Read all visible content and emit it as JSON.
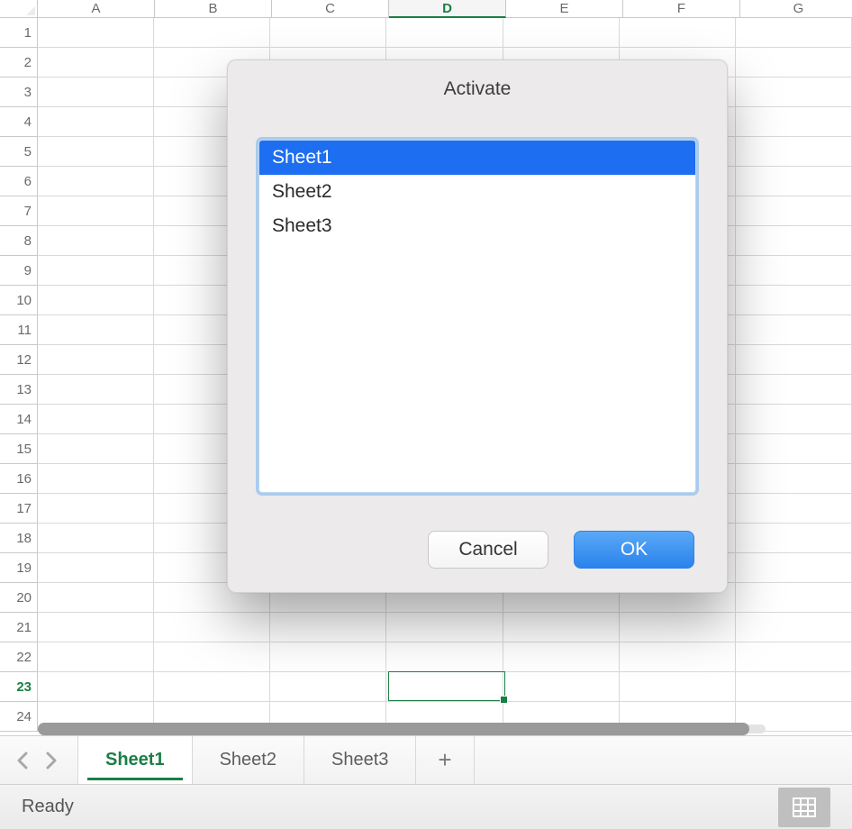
{
  "colors": {
    "accent_green": "#1a7f46",
    "accent_blue": "#1d6ef0"
  },
  "grid": {
    "columns": [
      "A",
      "B",
      "C",
      "D",
      "E",
      "F",
      "G"
    ],
    "rows": [
      "1",
      "2",
      "3",
      "4",
      "5",
      "6",
      "7",
      "8",
      "9",
      "10",
      "11",
      "12",
      "13",
      "14",
      "15",
      "16",
      "17",
      "18",
      "19",
      "20",
      "21",
      "22",
      "23",
      "24"
    ],
    "active_column_index": 3,
    "active_row_index": 22,
    "active_cell": "D23"
  },
  "sheet_tabs": {
    "prev_enabled": false,
    "next_enabled": false,
    "items": [
      "Sheet1",
      "Sheet2",
      "Sheet3"
    ],
    "active_index": 0,
    "add_label": "+"
  },
  "status": {
    "text": "Ready"
  },
  "dialog": {
    "title": "Activate",
    "items": [
      "Sheet1",
      "Sheet2",
      "Sheet3"
    ],
    "selected_index": 0,
    "buttons": {
      "cancel": "Cancel",
      "ok": "OK"
    }
  }
}
